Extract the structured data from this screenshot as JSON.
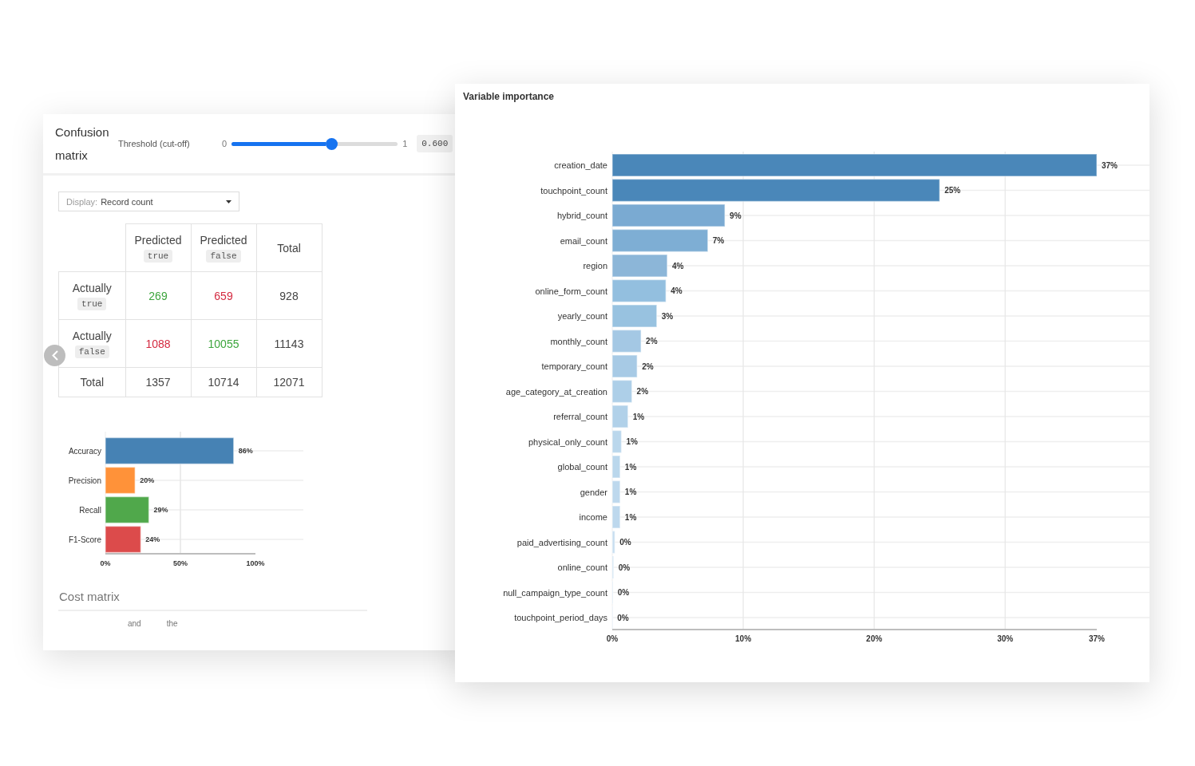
{
  "confusion_panel": {
    "title": "Confusion matrix",
    "threshold": {
      "label": "Threshold (cut-off)",
      "min_label": "0",
      "max_label": "1",
      "level": 0.6,
      "value": "0.600"
    },
    "display_select": {
      "label": "Display:",
      "value": "Record count"
    },
    "matrix": {
      "columns": [
        {
          "label": "Predicted",
          "code": "true"
        },
        {
          "label": "Predicted",
          "code": "false"
        },
        {
          "label": "Total"
        }
      ],
      "rows": [
        {
          "label": "Actually",
          "code": "true",
          "cells": [
            {
              "text": "269",
              "kind": "correct"
            },
            {
              "text": "659",
              "kind": "error"
            },
            {
              "text": "928",
              "kind": "plain"
            }
          ]
        },
        {
          "label": "Actually",
          "code": "false",
          "cells": [
            {
              "text": "1088",
              "kind": "error"
            },
            {
              "text": "10055",
              "kind": "correct"
            },
            {
              "text": "11143",
              "kind": "plain"
            }
          ]
        },
        {
          "label": "Total",
          "cells": [
            {
              "text": "1357",
              "kind": "plain"
            },
            {
              "text": "10714",
              "kind": "plain"
            },
            {
              "text": "12071",
              "kind": "plain"
            }
          ]
        }
      ]
    },
    "metrics": {
      "chart_data": [
        {
          "type": "bar",
          "orientation": "horizontal",
          "categories": [
            "Accuracy",
            "Precision",
            "Recall",
            "F1-Score"
          ],
          "values": [
            85.5,
            19.8,
            29.0,
            23.6
          ],
          "colors": [
            "#4682b4",
            "#ff9239",
            "#50a84b",
            "#dc4b4b"
          ],
          "xlim": [
            0,
            100
          ],
          "xticks": [
            {
              "value": 0,
              "label": "0%"
            },
            {
              "value": 50,
              "label": "50%"
            },
            {
              "value": 100,
              "label": "100%"
            }
          ],
          "value_labels": [
            "86%",
            "20%",
            "29%",
            "24%"
          ],
          "grid": "y",
          "ref_lines": [
            {
              "axis": "x",
              "value": 50,
              "color": "#e6e6e6"
            }
          ]
        }
      ]
    },
    "cost_matrix": {
      "title": "Cost matrix",
      "columns": [
        "and",
        "the"
      ]
    }
  },
  "importance_panel": {
    "title": "Variable importance",
    "chart_data": [
      {
        "type": "bar",
        "orientation": "horizontal",
        "categories": [
          "creation_date",
          "touchpoint_count",
          "hybrid_count",
          "email_count",
          "region",
          "online_form_count",
          "yearly_count",
          "monthly_count",
          "temporary_count",
          "age_category_at_creation",
          "referral_count",
          "physical_only_count",
          "global_count",
          "gender",
          "income",
          "paid_advertising_count",
          "online_count",
          "null_campaign_type_count",
          "touchpoint_period_days"
        ],
        "values": [
          37,
          25,
          8.6,
          7.3,
          4.2,
          4.1,
          3.4,
          2.2,
          1.9,
          1.5,
          1.2,
          0.7,
          0.6,
          0.6,
          0.6,
          0.2,
          0.1,
          0.05,
          0.02
        ],
        "colors": [
          "#4a87b9",
          "#4a87b9",
          "#7aaad2",
          "#7eaed4",
          "#8cb6d8",
          "#93bfdf",
          "#98c2e0",
          "#a4c8e4",
          "#a7cae5",
          "#adcfe8",
          "#b1d1e9",
          "#bad7ec",
          "#bad7ec",
          "#bdd8ed",
          "#bdd8ed",
          "#c8def0",
          "#cbe0f1",
          "#d2e5f3",
          "#d6e7f4"
        ],
        "xlim": [
          0,
          37
        ],
        "xticks": [
          {
            "value": 0,
            "label": "0%"
          },
          {
            "value": 10,
            "label": "10%"
          },
          {
            "value": 20,
            "label": "20%"
          },
          {
            "value": 30,
            "label": "30%"
          },
          {
            "value": 37,
            "label": "37%"
          }
        ],
        "value_labels": [
          "37%",
          "25%",
          "9%",
          "7%",
          "4%",
          "4%",
          "3%",
          "2%",
          "2%",
          "2%",
          "1%",
          "1%",
          "1%",
          "1%",
          "1%",
          "0%",
          "0%",
          "0%",
          "0%"
        ],
        "grid": true
      }
    ]
  }
}
